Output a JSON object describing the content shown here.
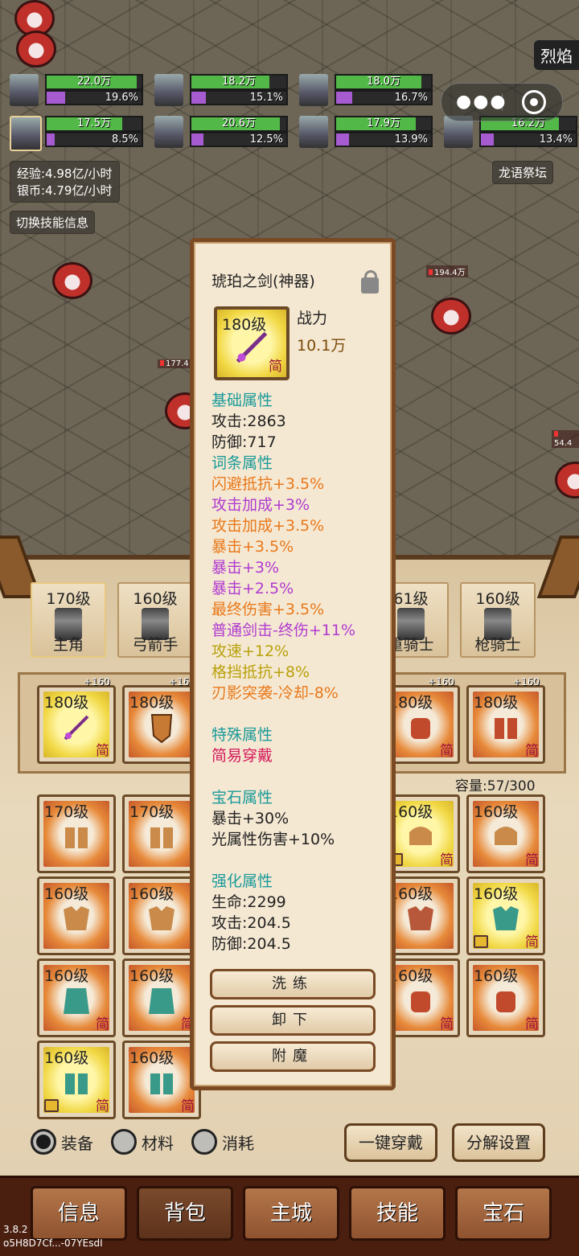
{
  "battle": {
    "flame_tag": "烈焰",
    "damage_popups": [
      "194.4万",
      "177.4",
      "54.4"
    ],
    "heroes": [
      {
        "hp": "22.0万",
        "hp_pct": 0.95,
        "mp": "19.6%",
        "mp_pct": 0.196
      },
      {
        "hp": "18.2万",
        "hp_pct": 0.82,
        "mp": "15.1%",
        "mp_pct": 0.151
      },
      {
        "hp": "18.0万",
        "hp_pct": 0.9,
        "mp": "16.7%",
        "mp_pct": 0.167
      },
      {
        "hp": "17.5万",
        "hp_pct": 0.8,
        "mp": "8.5%",
        "mp_pct": 0.085
      },
      {
        "hp": "20.6万",
        "hp_pct": 0.93,
        "mp": "12.5%",
        "mp_pct": 0.125
      },
      {
        "hp": "17.9万",
        "hp_pct": 0.84,
        "mp": "13.9%",
        "mp_pct": 0.139
      },
      {
        "hp": "16.2万",
        "hp_pct": 0.82,
        "mp": "13.4%",
        "mp_pct": 0.134
      }
    ],
    "exp_rate": "经验:4.98亿/小时",
    "silver_rate": "银币:4.79亿/小时",
    "switch_skill_info": "切换技能信息",
    "stage_name": "龙语祭坛"
  },
  "hero_tabs": [
    {
      "level": "170级",
      "role": "主角"
    },
    {
      "level": "160级",
      "role": "弓箭手"
    },
    {
      "level": "61级",
      "role": "重骑士"
    },
    {
      "level": "160级",
      "role": "枪骑士"
    }
  ],
  "equipped": [
    {
      "level": "180级",
      "plus": "+160",
      "simple": "简"
    },
    {
      "level": "180级",
      "plus": "+160",
      "simple": ""
    },
    {
      "level": "180级",
      "plus": "+160",
      "simple": "简"
    },
    {
      "level": "180级",
      "plus": "+160",
      "simple": "简"
    }
  ],
  "capacity": "容量:57/300",
  "inventory": {
    "row1": [
      {
        "level": "170级",
        "simple": ""
      },
      {
        "level": "170级",
        "simple": ""
      },
      {
        "level": "160级",
        "simple": "简"
      },
      {
        "level": "160级",
        "simple": "简"
      }
    ],
    "row2": [
      {
        "level": "160级",
        "simple": ""
      },
      {
        "level": "160级",
        "simple": ""
      },
      {
        "level": "160级",
        "simple": ""
      },
      {
        "level": "160级",
        "simple": "简"
      }
    ],
    "row3": [
      {
        "level": "160级",
        "simple": "简"
      },
      {
        "level": "160级",
        "simple": "简"
      },
      {
        "level": "160级",
        "simple": "简"
      },
      {
        "level": "160级",
        "simple": "简"
      }
    ],
    "row4": [
      {
        "level": "160级",
        "simple": "简"
      },
      {
        "level": "160级",
        "simple": "简"
      }
    ]
  },
  "filters": [
    {
      "label": "装备",
      "selected": true
    },
    {
      "label": "材料",
      "selected": false
    },
    {
      "label": "消耗",
      "selected": false
    }
  ],
  "actions": {
    "equip_all": "一键穿戴",
    "decompose_settings": "分解设置"
  },
  "nav": [
    "信息",
    "背包",
    "主城",
    "技能",
    "宝石"
  ],
  "version": {
    "line1": "3.8.2",
    "line2": "o5H8D7Cf...-07YEsdI"
  },
  "tooltip": {
    "title": "琥珀之剑(神器)",
    "icon_level": "180级",
    "icon_simple": "简",
    "power_label": "战力",
    "power_value": "10.1万",
    "base_header": "基础属性",
    "base": [
      "攻击:2863",
      "防御:717"
    ],
    "affix_header": "词条属性",
    "affixes": [
      {
        "text": "闪避抵抗+3.5%",
        "color": "orange"
      },
      {
        "text": "攻击加成+3%",
        "color": "purple"
      },
      {
        "text": "攻击加成+3.5%",
        "color": "orange"
      },
      {
        "text": "暴击+3.5%",
        "color": "orange"
      },
      {
        "text": "暴击+3%",
        "color": "purple"
      },
      {
        "text": "暴击+2.5%",
        "color": "purple"
      },
      {
        "text": "最终伤害+3.5%",
        "color": "orange"
      },
      {
        "text": "普通剑击-终伤+11%",
        "color": "purple"
      },
      {
        "text": "攻速+12%",
        "color": "yellow"
      },
      {
        "text": "格挡抵抗+8%",
        "color": "yellow"
      },
      {
        "text": "刃影突袭-冷却-8%",
        "color": "orange"
      }
    ],
    "special_header": "特殊属性",
    "special": "简易穿戴",
    "gem_header": "宝石属性",
    "gems": [
      "暴击+30%",
      "光属性伤害+10%"
    ],
    "enhance_header": "强化属性",
    "enhance": [
      "生命:2299",
      "攻击:204.5",
      "防御:204.5"
    ],
    "buttons": {
      "reforge": "洗练",
      "unequip": "卸下",
      "enchant": "附魔"
    }
  },
  "colors": {
    "hp": "#52b948",
    "mp": "#a65bd0",
    "orange": "#e8781a",
    "purple": "#b03ad0",
    "yellow": "#b8a10c",
    "teal": "#1a9a9a",
    "red": "#d4185a"
  }
}
